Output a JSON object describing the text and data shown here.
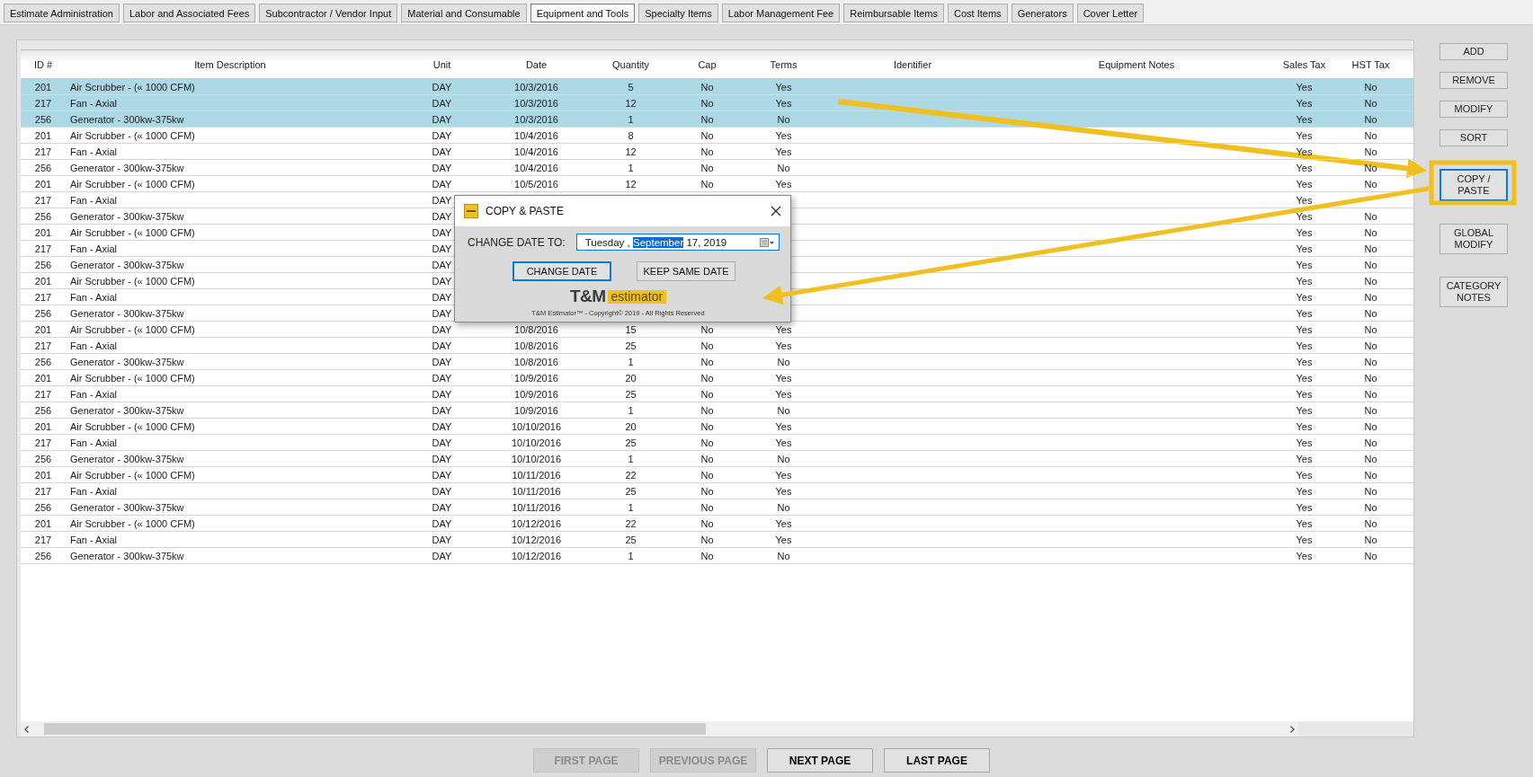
{
  "tabs": [
    {
      "label": "Estimate Administration",
      "selected": false
    },
    {
      "label": "Labor and Associated Fees",
      "selected": false
    },
    {
      "label": "Subcontractor / Vendor Input",
      "selected": false
    },
    {
      "label": "Material and Consumable",
      "selected": false
    },
    {
      "label": "Equipment and Tools",
      "selected": true
    },
    {
      "label": "Specialty Items",
      "selected": false
    },
    {
      "label": "Labor Management Fee",
      "selected": false
    },
    {
      "label": "Reimbursable Items",
      "selected": false
    },
    {
      "label": "Cost Items",
      "selected": false
    },
    {
      "label": "Generators",
      "selected": false
    },
    {
      "label": "Cover Letter",
      "selected": false
    }
  ],
  "table": {
    "columns": [
      "ID #",
      "Item Description",
      "Unit",
      "Date",
      "Quantity",
      "Cap",
      "Terms",
      "Identifier",
      "Equipment Notes",
      "Sales Tax",
      "HST Tax"
    ],
    "rows": [
      {
        "selected": true,
        "id": "201",
        "description": "Air Scrubber - (« 1000 CFM)",
        "unit": "DAY",
        "date": "10/3/2016",
        "quantity": "5",
        "cap": "No",
        "terms": "Yes",
        "sales_tax": "Yes",
        "hst_tax": "No"
      },
      {
        "selected": true,
        "id": "217",
        "description": "Fan - Axial",
        "unit": "DAY",
        "date": "10/3/2016",
        "quantity": "12",
        "cap": "No",
        "terms": "Yes",
        "sales_tax": "Yes",
        "hst_tax": "No"
      },
      {
        "selected": true,
        "id": "256",
        "description": "Generator - 300kw-375kw",
        "unit": "DAY",
        "date": "10/3/2016",
        "quantity": "1",
        "cap": "No",
        "terms": "No",
        "sales_tax": "Yes",
        "hst_tax": "No"
      },
      {
        "selected": false,
        "id": "201",
        "description": "Air Scrubber - (« 1000 CFM)",
        "unit": "DAY",
        "date": "10/4/2016",
        "quantity": "8",
        "cap": "No",
        "terms": "Yes",
        "sales_tax": "Yes",
        "hst_tax": "No"
      },
      {
        "selected": false,
        "id": "217",
        "description": "Fan - Axial",
        "unit": "DAY",
        "date": "10/4/2016",
        "quantity": "12",
        "cap": "No",
        "terms": "Yes",
        "sales_tax": "Yes",
        "hst_tax": "No"
      },
      {
        "selected": false,
        "id": "256",
        "description": "Generator - 300kw-375kw",
        "unit": "DAY",
        "date": "10/4/2016",
        "quantity": "1",
        "cap": "No",
        "terms": "No",
        "sales_tax": "Yes",
        "hst_tax": "No"
      },
      {
        "selected": false,
        "id": "201",
        "description": "Air Scrubber - (« 1000 CFM)",
        "unit": "DAY",
        "date": "10/5/2016",
        "quantity": "12",
        "cap": "No",
        "terms": "Yes",
        "sales_tax": "Yes",
        "hst_tax": "No"
      },
      {
        "selected": false,
        "id": "217",
        "description": "Fan - Axial",
        "unit": "DAY",
        "sales_tax": "Yes"
      },
      {
        "selected": false,
        "id": "256",
        "description": "Generator - 300kw-375kw",
        "unit": "DAY",
        "sales_tax": "Yes",
        "hst_tax": "No"
      },
      {
        "selected": false,
        "id": "201",
        "description": "Air Scrubber - (« 1000 CFM)",
        "unit": "DAY",
        "sales_tax": "Yes",
        "hst_tax": "No"
      },
      {
        "selected": false,
        "id": "217",
        "description": "Fan - Axial",
        "unit": "DAY",
        "sales_tax": "Yes",
        "hst_tax": "No"
      },
      {
        "selected": false,
        "id": "256",
        "description": "Generator - 300kw-375kw",
        "unit": "DAY",
        "sales_tax": "Yes",
        "hst_tax": "No"
      },
      {
        "selected": false,
        "id": "201",
        "description": "Air Scrubber - (« 1000 CFM)",
        "unit": "DAY",
        "sales_tax": "Yes",
        "hst_tax": "No"
      },
      {
        "selected": false,
        "id": "217",
        "description": "Fan - Axial",
        "unit": "DAY",
        "sales_tax": "Yes",
        "hst_tax": "No"
      },
      {
        "selected": false,
        "id": "256",
        "description": "Generator - 300kw-375kw",
        "unit": "DAY",
        "sales_tax": "Yes",
        "hst_tax": "No"
      },
      {
        "selected": false,
        "id": "201",
        "description": "Air Scrubber - (« 1000 CFM)",
        "unit": "DAY",
        "date": "10/8/2016",
        "quantity": "15",
        "cap": "No",
        "terms": "Yes",
        "sales_tax": "Yes",
        "hst_tax": "No"
      },
      {
        "selected": false,
        "id": "217",
        "description": "Fan - Axial",
        "unit": "DAY",
        "date": "10/8/2016",
        "quantity": "25",
        "cap": "No",
        "terms": "Yes",
        "sales_tax": "Yes",
        "hst_tax": "No"
      },
      {
        "selected": false,
        "id": "256",
        "description": "Generator - 300kw-375kw",
        "unit": "DAY",
        "date": "10/8/2016",
        "quantity": "1",
        "cap": "No",
        "terms": "No",
        "sales_tax": "Yes",
        "hst_tax": "No"
      },
      {
        "selected": false,
        "id": "201",
        "description": "Air Scrubber - (« 1000 CFM)",
        "unit": "DAY",
        "date": "10/9/2016",
        "quantity": "20",
        "cap": "No",
        "terms": "Yes",
        "sales_tax": "Yes",
        "hst_tax": "No"
      },
      {
        "selected": false,
        "id": "217",
        "description": "Fan - Axial",
        "unit": "DAY",
        "date": "10/9/2016",
        "quantity": "25",
        "cap": "No",
        "terms": "Yes",
        "sales_tax": "Yes",
        "hst_tax": "No"
      },
      {
        "selected": false,
        "id": "256",
        "description": "Generator - 300kw-375kw",
        "unit": "DAY",
        "date": "10/9/2016",
        "quantity": "1",
        "cap": "No",
        "terms": "No",
        "sales_tax": "Yes",
        "hst_tax": "No"
      },
      {
        "selected": false,
        "id": "201",
        "description": "Air Scrubber - (« 1000 CFM)",
        "unit": "DAY",
        "date": "10/10/2016",
        "quantity": "20",
        "cap": "No",
        "terms": "Yes",
        "sales_tax": "Yes",
        "hst_tax": "No"
      },
      {
        "selected": false,
        "id": "217",
        "description": "Fan - Axial",
        "unit": "DAY",
        "date": "10/10/2016",
        "quantity": "25",
        "cap": "No",
        "terms": "Yes",
        "sales_tax": "Yes",
        "hst_tax": "No"
      },
      {
        "selected": false,
        "id": "256",
        "description": "Generator - 300kw-375kw",
        "unit": "DAY",
        "date": "10/10/2016",
        "quantity": "1",
        "cap": "No",
        "terms": "No",
        "sales_tax": "Yes",
        "hst_tax": "No"
      },
      {
        "selected": false,
        "id": "201",
        "description": "Air Scrubber - (« 1000 CFM)",
        "unit": "DAY",
        "date": "10/11/2016",
        "quantity": "22",
        "cap": "No",
        "terms": "Yes",
        "sales_tax": "Yes",
        "hst_tax": "No"
      },
      {
        "selected": false,
        "id": "217",
        "description": "Fan - Axial",
        "unit": "DAY",
        "date": "10/11/2016",
        "quantity": "25",
        "cap": "No",
        "terms": "Yes",
        "sales_tax": "Yes",
        "hst_tax": "No"
      },
      {
        "selected": false,
        "id": "256",
        "description": "Generator - 300kw-375kw",
        "unit": "DAY",
        "date": "10/11/2016",
        "quantity": "1",
        "cap": "No",
        "terms": "No",
        "sales_tax": "Yes",
        "hst_tax": "No"
      },
      {
        "selected": false,
        "id": "201",
        "description": "Air Scrubber - (« 1000 CFM)",
        "unit": "DAY",
        "date": "10/12/2016",
        "quantity": "22",
        "cap": "No",
        "terms": "Yes",
        "sales_tax": "Yes",
        "hst_tax": "No"
      },
      {
        "selected": false,
        "id": "217",
        "description": "Fan - Axial",
        "unit": "DAY",
        "date": "10/12/2016",
        "quantity": "25",
        "cap": "No",
        "terms": "Yes",
        "sales_tax": "Yes",
        "hst_tax": "No"
      },
      {
        "selected": false,
        "id": "256",
        "description": "Generator - 300kw-375kw",
        "unit": "DAY",
        "date": "10/12/2016",
        "quantity": "1",
        "cap": "No",
        "terms": "No",
        "sales_tax": "Yes",
        "hst_tax": "No"
      }
    ]
  },
  "side_buttons": [
    {
      "label": "ADD",
      "focused": false
    },
    {
      "label": "REMOVE",
      "focused": false
    },
    {
      "label": "MODIFY",
      "focused": false
    },
    {
      "label": "SORT",
      "focused": false
    },
    {
      "label": "COPY / PASTE",
      "focused": true
    },
    {
      "label": "GLOBAL MODIFY",
      "focused": false
    },
    {
      "label": "CATEGORY NOTES",
      "focused": false
    }
  ],
  "pager": [
    {
      "label": "FIRST PAGE",
      "disabled": true
    },
    {
      "label": "PREVIOUS PAGE",
      "disabled": true
    },
    {
      "label": "NEXT PAGE",
      "disabled": false
    },
    {
      "label": "LAST PAGE",
      "disabled": false
    }
  ],
  "dialog": {
    "title": "COPY & PASTE",
    "field_label": "CHANGE DATE TO:",
    "date_parts": [
      {
        "text": "Tuesday",
        "selected": false
      },
      {
        "text": " , ",
        "selected": false
      },
      {
        "text": "September",
        "selected": true
      },
      {
        "text": " 17, 2019",
        "selected": false
      }
    ],
    "buttons": [
      {
        "label": "CHANGE DATE",
        "focused": true
      },
      {
        "label": "KEEP SAME DATE",
        "focused": false
      }
    ],
    "logo_text": "T&M",
    "logo_tag": "estimator",
    "copyright": "T&M Estimator™ - Copyright© 2019 - All Rights Reserved"
  }
}
